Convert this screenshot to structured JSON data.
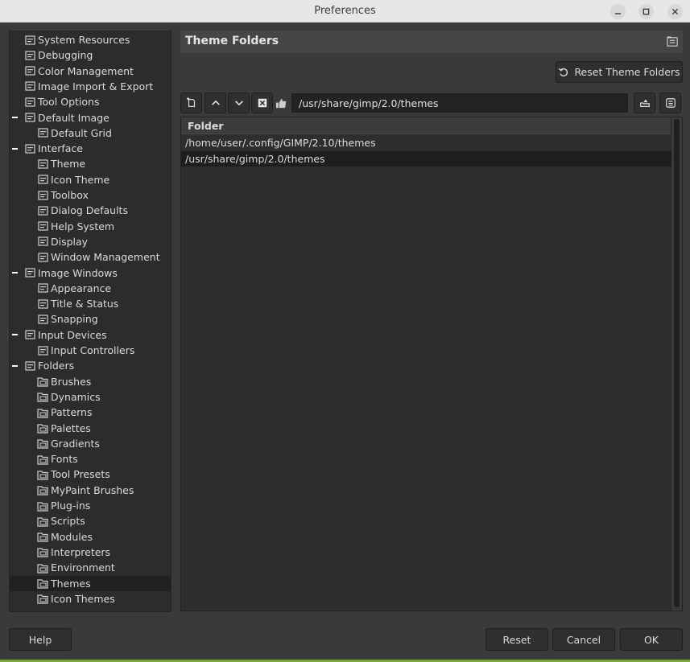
{
  "window": {
    "title": "Preferences"
  },
  "tree": {
    "items": [
      {
        "label": "System Resources",
        "level": 1,
        "icon": "chip-icon"
      },
      {
        "label": "Debugging",
        "level": 1,
        "icon": "bug-icon"
      },
      {
        "label": "Color Management",
        "level": 1,
        "icon": "color-management-icon"
      },
      {
        "label": "Image Import & Export",
        "level": 1,
        "icon": "import-export-icon"
      },
      {
        "label": "Tool Options",
        "level": 1,
        "icon": "tool-options-icon"
      },
      {
        "label": "Default Image",
        "level": 1,
        "icon": "default-image-icon",
        "expanded": true
      },
      {
        "label": "Default Grid",
        "level": 2,
        "icon": "grid-icon"
      },
      {
        "label": "Interface",
        "level": 1,
        "icon": "interface-icon",
        "expanded": true
      },
      {
        "label": "Theme",
        "level": 2,
        "icon": "theme-icon"
      },
      {
        "label": "Icon Theme",
        "level": 2,
        "icon": "icon-theme-icon"
      },
      {
        "label": "Toolbox",
        "level": 2,
        "icon": "toolbox-icon"
      },
      {
        "label": "Dialog Defaults",
        "level": 2,
        "icon": "dialog-defaults-icon"
      },
      {
        "label": "Help System",
        "level": 2,
        "icon": "help-system-icon"
      },
      {
        "label": "Display",
        "level": 2,
        "icon": "display-icon"
      },
      {
        "label": "Window Management",
        "level": 2,
        "icon": "window-management-icon"
      },
      {
        "label": "Image Windows",
        "level": 1,
        "icon": "image-windows-icon",
        "expanded": true
      },
      {
        "label": "Appearance",
        "level": 2,
        "icon": "appearance-icon"
      },
      {
        "label": "Title & Status",
        "level": 2,
        "icon": "title-status-icon"
      },
      {
        "label": "Snapping",
        "level": 2,
        "icon": "snapping-icon"
      },
      {
        "label": "Input Devices",
        "level": 1,
        "icon": "input-devices-icon",
        "expanded": true
      },
      {
        "label": "Input Controllers",
        "level": 2,
        "icon": "input-controllers-icon"
      },
      {
        "label": "Folders",
        "level": 1,
        "icon": "folders-icon",
        "expanded": true
      },
      {
        "label": "Brushes",
        "level": 2,
        "icon": "folder-brushes-icon"
      },
      {
        "label": "Dynamics",
        "level": 2,
        "icon": "folder-dynamics-icon"
      },
      {
        "label": "Patterns",
        "level": 2,
        "icon": "folder-patterns-icon"
      },
      {
        "label": "Palettes",
        "level": 2,
        "icon": "folder-palettes-icon"
      },
      {
        "label": "Gradients",
        "level": 2,
        "icon": "folder-gradients-icon"
      },
      {
        "label": "Fonts",
        "level": 2,
        "icon": "folder-fonts-icon"
      },
      {
        "label": "Tool Presets",
        "level": 2,
        "icon": "folder-tool-presets-icon"
      },
      {
        "label": "MyPaint Brushes",
        "level": 2,
        "icon": "folder-mypaint-icon"
      },
      {
        "label": "Plug-ins",
        "level": 2,
        "icon": "folder-plugins-icon"
      },
      {
        "label": "Scripts",
        "level": 2,
        "icon": "folder-scripts-icon"
      },
      {
        "label": "Modules",
        "level": 2,
        "icon": "folder-modules-icon"
      },
      {
        "label": "Interpreters",
        "level": 2,
        "icon": "folder-interpreters-icon"
      },
      {
        "label": "Environment",
        "level": 2,
        "icon": "folder-environment-icon"
      },
      {
        "label": "Themes",
        "level": 2,
        "icon": "folder-themes-icon",
        "selected": true
      },
      {
        "label": "Icon Themes",
        "level": 2,
        "icon": "folder-icon-themes-icon"
      }
    ]
  },
  "panel": {
    "title": "Theme Folders",
    "reset_button": "Reset Theme Folders",
    "path_value": "/usr/share/gimp/2.0/themes",
    "column_header": "Folder",
    "folders": [
      {
        "path": "/home/user/.config/GIMP/2.10/themes",
        "selected": false
      },
      {
        "path": "/usr/share/gimp/2.0/themes",
        "selected": true
      }
    ]
  },
  "footer": {
    "help": "Help",
    "reset": "Reset",
    "cancel": "Cancel",
    "ok": "OK"
  },
  "colors": {
    "background": "#3a3a3a",
    "tree_bg": "#2c2c2c",
    "selected_bg": "#212121",
    "accent_strip": "#7aa33a"
  }
}
